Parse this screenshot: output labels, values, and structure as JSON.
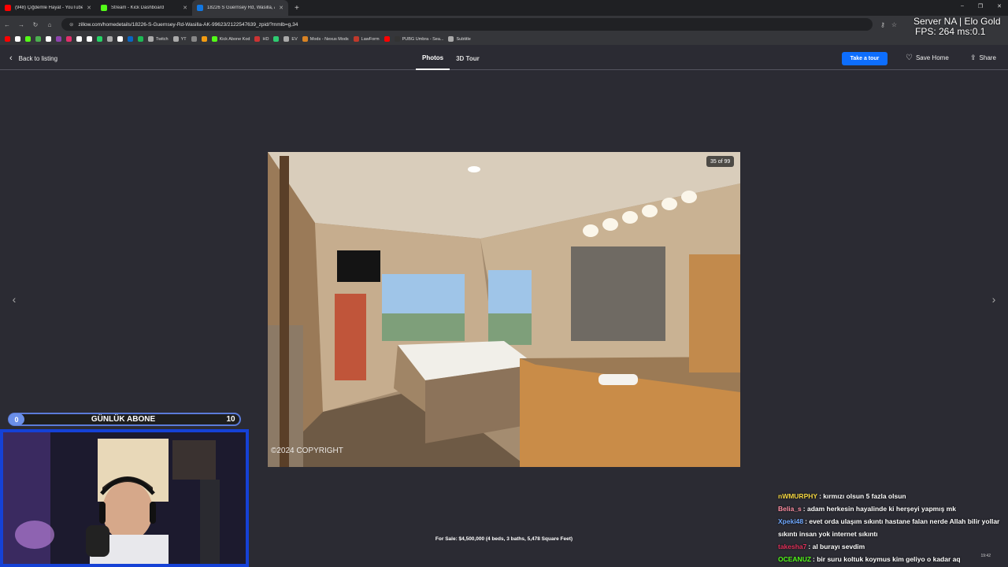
{
  "browser": {
    "tabs": [
      {
        "title": "(948) Çiğdemle Hayat - YouTube",
        "color": "#ff0000",
        "active": false
      },
      {
        "title": "Stream - Kick Dashboard",
        "color": "#53fc18",
        "active": false
      },
      {
        "title": "18226 S Guernsey Rd, Wasilla, A",
        "color": "#1277e1",
        "active": true
      }
    ],
    "url": "zillow.com/homedetails/18226-S-Guernsey-Rd-Wasilla-AK-99623/2122547639_zpid/?mmlb=g,34",
    "bookmarks": [
      {
        "label": "",
        "color": "#ff0000"
      },
      {
        "label": "",
        "color": "#ffffff"
      },
      {
        "label": "",
        "color": "#53fc18"
      },
      {
        "label": "",
        "color": "#4caf50"
      },
      {
        "label": "",
        "color": "#ffffff"
      },
      {
        "label": "",
        "color": "#8e44ad"
      },
      {
        "label": "",
        "color": "#e1306c"
      },
      {
        "label": "",
        "color": "#ffffff"
      },
      {
        "label": "",
        "color": "#ffffff"
      },
      {
        "label": "",
        "color": "#25d366"
      },
      {
        "label": "",
        "color": "#aaaaaa"
      },
      {
        "label": "",
        "color": "#ffffff"
      },
      {
        "label": "",
        "color": "#0a66c2"
      },
      {
        "label": "",
        "color": "#1db954"
      },
      {
        "label": "Twitch",
        "color": "#aaaaaa"
      },
      {
        "label": "YT",
        "color": "#aaaaaa"
      },
      {
        "label": "",
        "color": "#888888"
      },
      {
        "label": "",
        "color": "#f39c12"
      },
      {
        "label": "Kick Abone Kod",
        "color": "#53fc18"
      },
      {
        "label": "HD",
        "color": "#cc3333"
      },
      {
        "label": "",
        "color": "#2ecc71"
      },
      {
        "label": "EV",
        "color": "#aaaaaa"
      },
      {
        "label": "Mods - Nexus Mods",
        "color": "#d98324"
      },
      {
        "label": "LawForm",
        "color": "#c0392b"
      },
      {
        "label": "",
        "color": "#ff0000"
      },
      {
        "label": "PUBG Umbra - Sea...",
        "color": "#333333"
      },
      {
        "label": "Subtitle",
        "color": "#aaaaaa"
      }
    ]
  },
  "overlay": {
    "server_line": "Server NA | Elo Gold",
    "fps_line": "FPS: 264 ms:0.1",
    "abone_label": "GÜNLÜK ABONE",
    "abone_current": "0",
    "abone_goal": "10"
  },
  "zillow": {
    "back_label": "Back to listing",
    "tabs": [
      "Photos",
      "3D Tour"
    ],
    "take_tour": "Take a tour",
    "save_home": "Save Home",
    "share": "Share",
    "counter": "35 of 99",
    "watermark": "©2024 COPYRIGHT",
    "caption": "For Sale: $4,500,000 (4 beds, 3 baths, 5,478 Square Feet)"
  },
  "chat": [
    {
      "name": "nWMURPHY",
      "color": "#f5d742",
      "text": "kırmızı olsun 5 fazla olsun"
    },
    {
      "name": "Belia_s",
      "color": "#ff8fa3",
      "text": "adam herkesin hayalinde ki herşeyi yapmış mk"
    },
    {
      "name": "Xpeki48",
      "color": "#6fa8ff",
      "text": "evet orda ulaşım sıkıntı hastane falan nerde Allah bilir yollar sıkıntı insan yok internet sıkıntı"
    },
    {
      "name": "takesha7",
      "color": "#e0315a",
      "text": "al burayı sevdim"
    },
    {
      "name": "OCEANUZ",
      "color": "#53fc18",
      "text": "bir suru koltuk koymus kim geliyo o kadar aq"
    }
  ],
  "clock": "19:42"
}
